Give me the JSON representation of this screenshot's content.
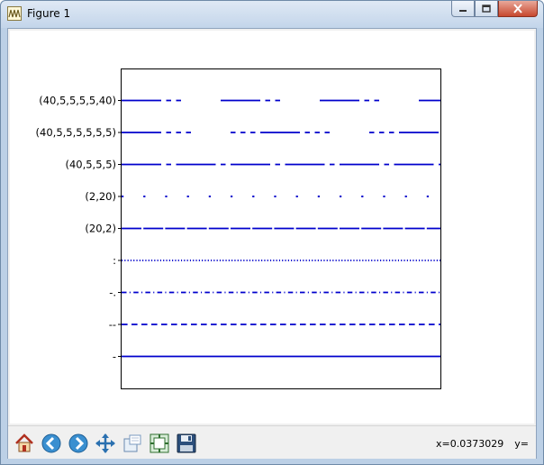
{
  "window": {
    "title": "Figure 1",
    "icon": "matplotlib-figure-icon",
    "controls": [
      "minimize-icon",
      "maximize-icon",
      "close-icon"
    ]
  },
  "toolbar": {
    "buttons": [
      {
        "name": "home",
        "icon": "home-icon"
      },
      {
        "name": "back",
        "icon": "back-arrow-icon"
      },
      {
        "name": "forward",
        "icon": "forward-arrow-icon"
      },
      {
        "name": "pan",
        "icon": "pan-move-icon"
      },
      {
        "name": "zoom",
        "icon": "zoom-rect-icon"
      },
      {
        "name": "configure-subplots",
        "icon": "subplots-icon"
      },
      {
        "name": "save",
        "icon": "floppy-disk-icon"
      }
    ],
    "coords": {
      "x_text": "x=0.0373029",
      "y_text": "y="
    }
  },
  "chart_data": {
    "type": "line",
    "title": "",
    "xlabel": "",
    "ylabel": "",
    "line_color": "#0000cc",
    "grid": false,
    "series": [
      {
        "name": "(40,5,5,5,5,40)",
        "dashes": [
          40,
          5,
          5,
          5,
          5,
          40
        ]
      },
      {
        "name": "(40,5,5,5,5,5,5)",
        "dashes": [
          40,
          5,
          5,
          5,
          5,
          5,
          5
        ]
      },
      {
        "name": "(40,5,5,5)",
        "dashes": [
          40,
          5,
          5,
          5
        ]
      },
      {
        "name": "(2,20)",
        "dashes": [
          2,
          20
        ]
      },
      {
        "name": "(20,2)",
        "dashes": [
          20,
          2
        ]
      },
      {
        "name": ":",
        "dashes": [
          1,
          2
        ]
      },
      {
        "name": "-.",
        "dashes": [
          5,
          3,
          1,
          3
        ]
      },
      {
        "name": "--",
        "dashes": [
          6,
          4
        ]
      },
      {
        "name": "-",
        "dashes": []
      }
    ]
  }
}
